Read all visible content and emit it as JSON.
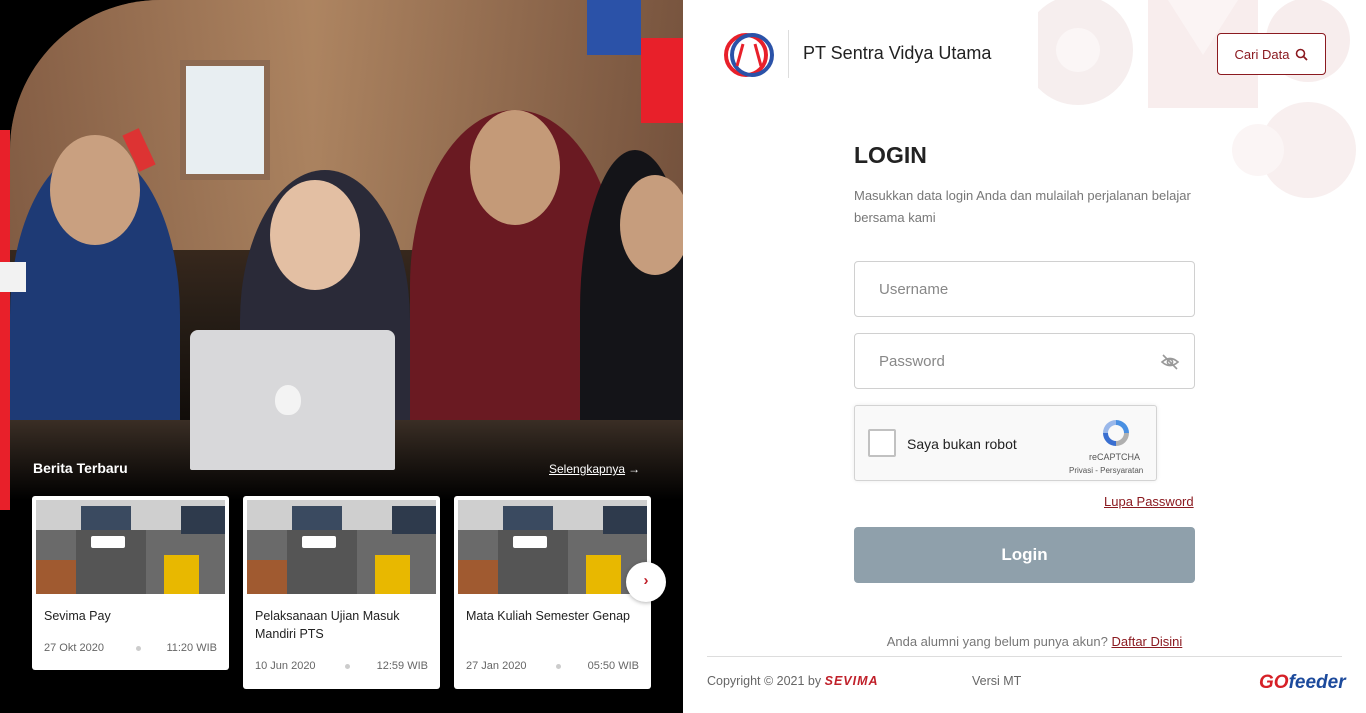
{
  "news": {
    "title": "Berita Terbaru",
    "more_label": "Selengkapnya",
    "more_arrow": "→",
    "next_glyph": "›",
    "items": [
      {
        "title": "Sevima Pay",
        "date": "27 Okt 2020",
        "time": "11:20 WIB"
      },
      {
        "title": "Pelaksanaan Ujian Masuk Mandiri PTS",
        "date": "10 Jun 2020",
        "time": "12:59 WIB"
      },
      {
        "title": "Mata Kuliah Semester Genap",
        "date": "27 Jan 2020",
        "time": "05:50 WIB"
      }
    ]
  },
  "header": {
    "company": "PT Sentra Vidya Utama",
    "search_button": "Cari Data"
  },
  "login": {
    "title": "LOGIN",
    "description": "Masukkan data login Anda dan mulailah perjalanan belajar bersama kami",
    "username_placeholder": "Username",
    "password_placeholder": "Password",
    "captcha_label": "Saya bukan robot",
    "captcha_brand": "reCAPTCHA",
    "captcha_links": "Privasi - Persyaratan",
    "forgot_password": "Lupa Password",
    "submit": "Login"
  },
  "footer": {
    "alumni_text": "Anda alumni yang belum punya akun?",
    "register_link": "Daftar Disini",
    "copyright": "Copyright © 2021 by",
    "sevima": "SEVIMA",
    "version": "Versi MT",
    "gofeeder_go": "GO",
    "gofeeder_feeder": "feeder"
  },
  "colors": {
    "accent": "#8b1a20",
    "brand_red": "#e8202a",
    "brand_blue": "#2b52a8",
    "button_disabled": "#8fa0ab"
  }
}
